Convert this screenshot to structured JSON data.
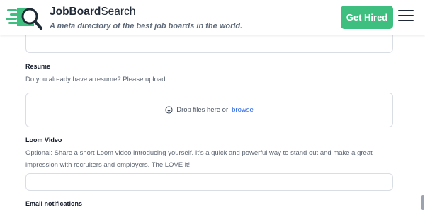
{
  "header": {
    "brand_bold": "JobBoard",
    "brand_rest": "Search",
    "tagline": "A meta directory of the best job boards in the world.",
    "cta_label": "Get Hired",
    "colors": {
      "cta": "#3fbf7f",
      "logo_green": "#3fbf7f",
      "logo_dark": "#1f2a37"
    },
    "icons": [
      "logo-magnifier-icon",
      "hamburger-menu-icon"
    ]
  },
  "form": {
    "resume": {
      "label": "Resume",
      "description": "Do you already have a resume? Please upload",
      "drop_text": "Drop files here or",
      "browse_label": "browse",
      "icon": "download-circle-icon"
    },
    "loom": {
      "label": "Loom Video",
      "description_line1": "Optional: Share a short Loom video introducing yourself. It's a quick and powerful way to stand out and make a great",
      "description_line2": "impression with recruiters and employers. The LOVE it!",
      "input_value": ""
    },
    "email": {
      "label": "Email notifications"
    }
  }
}
